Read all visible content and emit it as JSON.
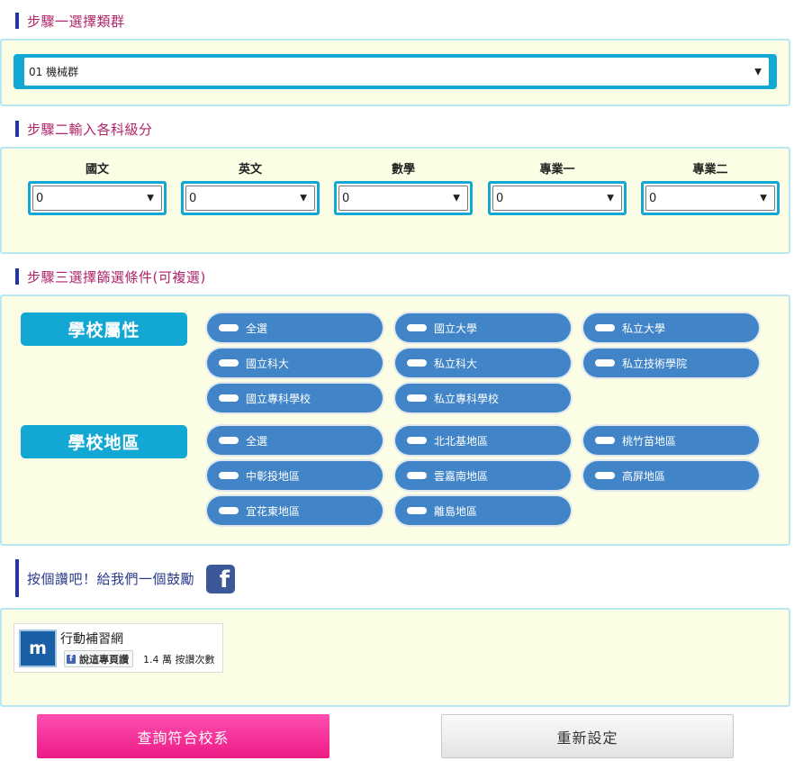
{
  "step1": {
    "title": "步驟一選擇類群",
    "selected": "01 機械群"
  },
  "step2": {
    "title": "步驟二輸入各科級分",
    "subjects": [
      {
        "label": "國文",
        "value": "0"
      },
      {
        "label": "英文",
        "value": "0"
      },
      {
        "label": "數學",
        "value": "0"
      },
      {
        "label": "專業一",
        "value": "0"
      },
      {
        "label": "專業二",
        "value": "0"
      }
    ]
  },
  "step3": {
    "title": "步驟三選擇篩選條件(可複選)",
    "groups": [
      {
        "label": "學校屬性",
        "options": [
          "全選",
          "國立大學",
          "私立大學",
          "國立科大",
          "私立科大",
          "私立技術學院",
          "國立專科學校",
          "私立專科學校"
        ]
      },
      {
        "label": "學校地區",
        "options": [
          "全選",
          "北北基地區",
          "桃竹苗地區",
          "中彰投地區",
          "雲嘉南地區",
          "高屏地區",
          "宜花東地區",
          "離島地區"
        ]
      }
    ]
  },
  "step4": {
    "title": "按個讚吧！給我們一個鼓勵",
    "fb_icon": "f",
    "likebox": {
      "logo_text": "m",
      "page_name": "行動補習網",
      "like_button": "說這專頁讚",
      "like_count": "1.4 萬 按讚次數"
    }
  },
  "buttons": {
    "query": "查詢符合校系",
    "reset": "重新設定"
  },
  "colors": {
    "accent_cyan": "#13a8d4",
    "pill_blue": "#4185c8",
    "title_magenta": "#b0246a",
    "panel_bg": "#fbfde4",
    "query_pink": "#ec1b86"
  }
}
